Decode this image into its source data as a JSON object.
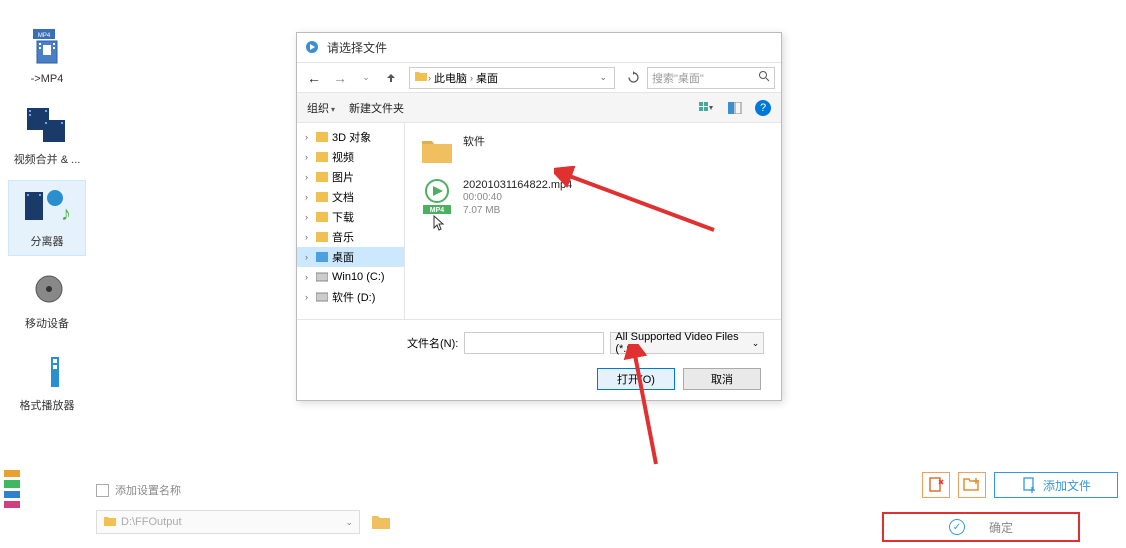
{
  "sidebar": {
    "items": [
      {
        "label": "->MP4"
      },
      {
        "label": "视频合并 & ..."
      },
      {
        "label": "分离器"
      },
      {
        "label": "移动设备"
      },
      {
        "label": "格式播放器"
      }
    ]
  },
  "dialog": {
    "title": "请选择文件",
    "breadcrumb": {
      "root": "此电脑",
      "current": "桌面"
    },
    "search_placeholder": "搜索\"桌面\"",
    "toolbar": {
      "organize": "组织",
      "new_folder": "新建文件夹"
    },
    "tree": [
      {
        "label": "3D 对象"
      },
      {
        "label": "视频"
      },
      {
        "label": "图片"
      },
      {
        "label": "文档"
      },
      {
        "label": "下载"
      },
      {
        "label": "音乐"
      },
      {
        "label": "桌面",
        "selected": true
      },
      {
        "label": "Win10 (C:)"
      },
      {
        "label": "软件 (D:)"
      }
    ],
    "files": {
      "folder": {
        "name": "软件"
      },
      "video": {
        "name": "20201031164822.mp4",
        "duration": "00:00:40",
        "size": "7.07 MB",
        "badge": "MP4"
      }
    },
    "footer": {
      "filename_label": "文件名(N):",
      "filetype": "All Supported Video Files (*.m",
      "open": "打开(O)",
      "cancel": "取消"
    }
  },
  "bottom": {
    "checkbox_label": "添加设置名称",
    "path": "D:\\FFOutput",
    "add_file": "添加文件",
    "confirm": "确定"
  }
}
